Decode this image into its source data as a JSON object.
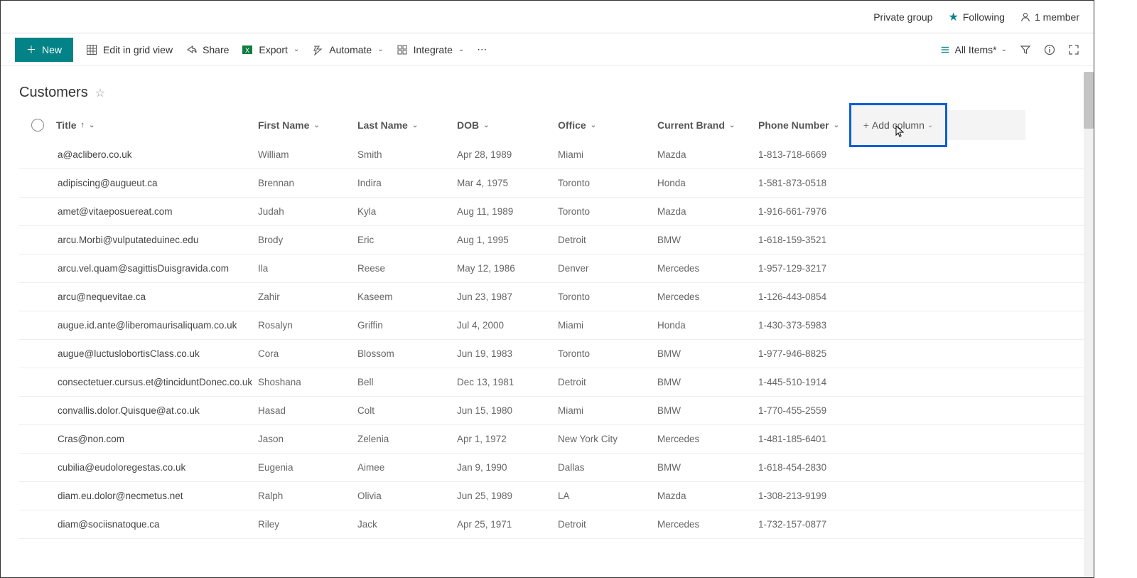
{
  "header": {
    "privacy": "Private group",
    "following": "Following",
    "members": "1 member"
  },
  "commands": {
    "new": "New",
    "edit_grid": "Edit in grid view",
    "share": "Share",
    "export": "Export",
    "automate": "Automate",
    "integrate": "Integrate",
    "view_label": "All Items*"
  },
  "list": {
    "title": "Customers"
  },
  "columns": {
    "title": "Title",
    "first_name": "First Name",
    "last_name": "Last Name",
    "dob": "DOB",
    "office": "Office",
    "current_brand": "Current Brand",
    "phone": "Phone Number",
    "add_column": "Add column"
  },
  "rows": [
    {
      "title": "a@aclibero.co.uk",
      "fn": "William",
      "ln": "Smith",
      "dob": "Apr 28, 1989",
      "off": "Miami",
      "brand": "Mazda",
      "phone": "1-813-718-6669"
    },
    {
      "title": "adipiscing@augueut.ca",
      "fn": "Brennan",
      "ln": "Indira",
      "dob": "Mar 4, 1975",
      "off": "Toronto",
      "brand": "Honda",
      "phone": "1-581-873-0518"
    },
    {
      "title": "amet@vitaeposuereat.com",
      "fn": "Judah",
      "ln": "Kyla",
      "dob": "Aug 11, 1989",
      "off": "Toronto",
      "brand": "Mazda",
      "phone": "1-916-661-7976"
    },
    {
      "title": "arcu.Morbi@vulputateduinec.edu",
      "fn": "Brody",
      "ln": "Eric",
      "dob": "Aug 1, 1995",
      "off": "Detroit",
      "brand": "BMW",
      "phone": "1-618-159-3521"
    },
    {
      "title": "arcu.vel.quam@sagittisDuisgravida.com",
      "fn": "Ila",
      "ln": "Reese",
      "dob": "May 12, 1986",
      "off": "Denver",
      "brand": "Mercedes",
      "phone": "1-957-129-3217"
    },
    {
      "title": "arcu@nequevitae.ca",
      "fn": "Zahir",
      "ln": "Kaseem",
      "dob": "Jun 23, 1987",
      "off": "Toronto",
      "brand": "Mercedes",
      "phone": "1-126-443-0854"
    },
    {
      "title": "augue.id.ante@liberomaurisaliquam.co.uk",
      "fn": "Rosalyn",
      "ln": "Griffin",
      "dob": "Jul 4, 2000",
      "off": "Miami",
      "brand": "Honda",
      "phone": "1-430-373-5983"
    },
    {
      "title": "augue@luctuslobortisClass.co.uk",
      "fn": "Cora",
      "ln": "Blossom",
      "dob": "Jun 19, 1983",
      "off": "Toronto",
      "brand": "BMW",
      "phone": "1-977-946-8825"
    },
    {
      "title": "consectetuer.cursus.et@tinciduntDonec.co.uk",
      "fn": "Shoshana",
      "ln": "Bell",
      "dob": "Dec 13, 1981",
      "off": "Detroit",
      "brand": "BMW",
      "phone": "1-445-510-1914"
    },
    {
      "title": "convallis.dolor.Quisque@at.co.uk",
      "fn": "Hasad",
      "ln": "Colt",
      "dob": "Jun 15, 1980",
      "off": "Miami",
      "brand": "BMW",
      "phone": "1-770-455-2559"
    },
    {
      "title": "Cras@non.com",
      "fn": "Jason",
      "ln": "Zelenia",
      "dob": "Apr 1, 1972",
      "off": "New York City",
      "brand": "Mercedes",
      "phone": "1-481-185-6401"
    },
    {
      "title": "cubilia@eudoloregestas.co.uk",
      "fn": "Eugenia",
      "ln": "Aimee",
      "dob": "Jan 9, 1990",
      "off": "Dallas",
      "brand": "BMW",
      "phone": "1-618-454-2830"
    },
    {
      "title": "diam.eu.dolor@necmetus.net",
      "fn": "Ralph",
      "ln": "Olivia",
      "dob": "Jun 25, 1989",
      "off": "LA",
      "brand": "Mazda",
      "phone": "1-308-213-9199"
    },
    {
      "title": "diam@sociisnatoque.ca",
      "fn": "Riley",
      "ln": "Jack",
      "dob": "Apr 25, 1971",
      "off": "Detroit",
      "brand": "Mercedes",
      "phone": "1-732-157-0877"
    }
  ]
}
